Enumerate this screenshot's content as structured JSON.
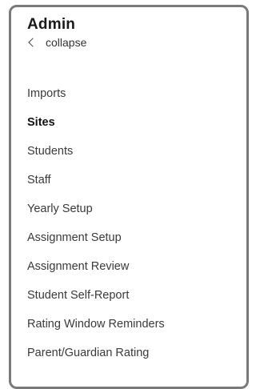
{
  "header": {
    "title": "Admin",
    "collapse_label": "collapse"
  },
  "nav": {
    "items": [
      {
        "label": "Imports",
        "active": false
      },
      {
        "label": "Sites",
        "active": true
      },
      {
        "label": "Students",
        "active": false
      },
      {
        "label": "Staff",
        "active": false
      },
      {
        "label": "Yearly Setup",
        "active": false
      },
      {
        "label": "Assignment Setup",
        "active": false
      },
      {
        "label": "Assignment Review",
        "active": false
      },
      {
        "label": "Student Self-Report",
        "active": false
      },
      {
        "label": "Rating Window Reminders",
        "active": false
      },
      {
        "label": "Parent/Guardian Rating",
        "active": false
      }
    ]
  },
  "icons": {
    "collapse": "chevron-left-icon"
  },
  "colors": {
    "border": "#7a7a7a",
    "text": "#3a3a3a",
    "active_text": "#111111"
  }
}
